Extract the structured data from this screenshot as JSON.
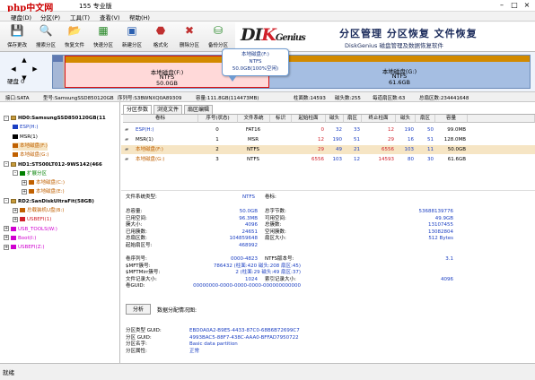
{
  "window": {
    "watermark": "php中文网",
    "title": "155 专业版"
  },
  "menu": [
    "硬盘(D)",
    "分区(P)",
    "工具(T)",
    "查看(V)",
    "帮助(H)"
  ],
  "toolbar": {
    "buttons": [
      {
        "label": "保存更改",
        "icon": "save-icon"
      },
      {
        "label": "搜索分区",
        "icon": "search-icon"
      },
      {
        "label": "恢复文件",
        "icon": "recover-icon"
      },
      {
        "label": "快速分区",
        "icon": "quick-partition-icon"
      },
      {
        "label": "新建分区",
        "icon": "new-partition-icon"
      },
      {
        "label": "格式化",
        "icon": "format-icon"
      },
      {
        "label": "删除分区",
        "icon": "delete-icon"
      },
      {
        "label": "备份分区",
        "icon": "backup-icon"
      }
    ],
    "logo": {
      "brand_a": "DI",
      "brand_k": "K",
      "brand_b": "Genius",
      "slogan": "分区管理 分区恢复 文件恢复",
      "sub": "DiskGenius 磁盘管理及数据恢复软件"
    }
  },
  "diskmap": {
    "disk_label": "硬盘 0",
    "segments": [
      {
        "name": "本地磁盘(F:)",
        "fs": "NTFS",
        "size": "50.0GB",
        "selected": true
      },
      {
        "name": "本地磁盘(G:)",
        "fs": "NTFS",
        "size": "61.6GB",
        "selected": false
      }
    ],
    "tooltip": [
      "本地磁盘(F:)",
      "NTFS",
      "50.0GB(100%空闲)"
    ]
  },
  "infobar": [
    "接口:SATA",
    "型号:SamsungSSD850120GB",
    "序列号:S3BWNXQ0A89309",
    "容量:111.8GB(114473MB)",
    "柱面数:14593",
    "磁头数:255",
    "每道扇区数:63",
    "总扇区数:234441648"
  ],
  "tree": [
    {
      "label": "HD0:SamsungSSD850120GB(11",
      "indent": 0,
      "expander": "-",
      "kind": "disk",
      "color": "#000",
      "bold": true
    },
    {
      "label": "ESP(H:)",
      "indent": 1,
      "expander": "",
      "kind": "part",
      "color": "#1b3fc2"
    },
    {
      "label": "MSR(1)",
      "indent": 1,
      "expander": "",
      "kind": "part",
      "color": "#000"
    },
    {
      "label": "本地磁盘(F:)",
      "indent": 1,
      "expander": "",
      "kind": "part",
      "color": "#c06000",
      "selected": true
    },
    {
      "label": "本地磁盘(G:)",
      "indent": 1,
      "expander": "",
      "kind": "part",
      "color": "#c06000"
    },
    {
      "label": "HD1:ST500LT012-9WS142(466",
      "indent": 0,
      "expander": "-",
      "kind": "disk",
      "color": "#000",
      "bold": true
    },
    {
      "label": "扩展分区",
      "indent": 1,
      "expander": "-",
      "kind": "part",
      "color": "#008000"
    },
    {
      "label": "本地磁盘(C:)",
      "indent": 2,
      "expander": "+",
      "kind": "part",
      "color": "#c06000"
    },
    {
      "label": "本地磁盘(E:)",
      "indent": 2,
      "expander": "+",
      "kind": "part",
      "color": "#c06000"
    },
    {
      "label": "RD2:SanDiskUltraFit(58GB)",
      "indent": 0,
      "expander": "-",
      "kind": "disk",
      "color": "#000",
      "bold": true
    },
    {
      "label": "总载装机U盘(B:)",
      "indent": 1,
      "expander": "+",
      "kind": "part",
      "color": "#c06000"
    },
    {
      "label": "USBEFI(1)",
      "indent": 1,
      "expander": "+",
      "kind": "part",
      "color": "#d0202a"
    },
    {
      "label": "USB_TOOLS(W:)",
      "indent": 0,
      "expander": "+",
      "kind": "part",
      "color": "#d000d0"
    },
    {
      "label": "Boot(I:)",
      "indent": 0,
      "expander": "+",
      "kind": "part",
      "color": "#d000d0"
    },
    {
      "label": "USBEFI(Z:)",
      "indent": 0,
      "expander": "+",
      "kind": "part",
      "color": "#d000d0"
    }
  ],
  "tabs": [
    "分区参数",
    "浏览文件",
    "扇区编辑"
  ],
  "partition_table": {
    "headers": [
      "卷标",
      "序号(状态)",
      "文件系统",
      "标识",
      "起始柱面",
      "磁头",
      "扇区",
      "终止柱面",
      "磁头",
      "扇区",
      "容量"
    ],
    "rows": [
      {
        "cells": [
          "ESP(H:)",
          "0",
          "FAT16",
          "",
          "0",
          "32",
          "33",
          "12",
          "190",
          "50",
          "99.0MB"
        ],
        "color": "#1b3fc2",
        "selected": false
      },
      {
        "cells": [
          "MSR(1)",
          "1",
          "MSR",
          "",
          "12",
          "190",
          "51",
          "29",
          "16",
          "51",
          "128.0MB"
        ],
        "color": "#000",
        "selected": false
      },
      {
        "cells": [
          "本地磁盘(F:)",
          "2",
          "NTFS",
          "",
          "29",
          "49",
          "21",
          "6556",
          "103",
          "11",
          "50.0GB"
        ],
        "color": "#c06000",
        "selected": true
      },
      {
        "cells": [
          "本地磁盘(G:)",
          "3",
          "NTFS",
          "",
          "6556",
          "103",
          "12",
          "14593",
          "80",
          "30",
          "61.6GB"
        ],
        "color": "#c06000",
        "selected": false
      }
    ]
  },
  "details": {
    "fs_type_label": "文件系统类型:",
    "fs_type": "NTFS",
    "vol_label_label": "卷标:",
    "rows": [
      {
        "l1": "总容量:",
        "v1": "50.0GB",
        "l2": "总字节数:",
        "v2": "53688139776"
      },
      {
        "l1": "已用空间:",
        "v1": "96.3MB",
        "l2": "可用空间:",
        "v2": "49.9GB"
      },
      {
        "l1": "簇大小:",
        "v1": "4096",
        "l2": "总簇数:",
        "v2": "13107455"
      },
      {
        "l1": "已用簇数:",
        "v1": "24651",
        "l2": "空闲簇数:",
        "v2": "13082804"
      },
      {
        "l1": "总扇区数:",
        "v1": "104859648",
        "l2": "扇区大小:",
        "v2": "512 Bytes"
      },
      {
        "l1": "起始扇区号:",
        "v1": "468992",
        "l2": "",
        "v2": ""
      }
    ],
    "rows2": [
      {
        "l1": "卷序列号:",
        "v1": "0000-4823",
        "l2": "NTFS版本号:",
        "v2": "3.1"
      },
      {
        "l1": "$MFT簇号:",
        "v1": "786432 (柱面:420 磁头:208 扇区:45)",
        "l2": "",
        "v2": ""
      },
      {
        "l1": "$MFTMirr簇号:",
        "v1": "2 (柱面:29 磁头:49 扇区:37)",
        "l2": "",
        "v2": ""
      },
      {
        "l1": "文件记录大小:",
        "v1": "1024",
        "l2": "索引记录大小:",
        "v2": "4096"
      },
      {
        "l1": "卷GUID:",
        "v1": "00000000-0000-0000-0000-000000000000",
        "l2": "",
        "v2": ""
      }
    ],
    "analyze_button": "分析",
    "analyze_label": "数据分配情况图:",
    "guid": [
      {
        "l": "分区类型 GUID:",
        "v": "EBD0A0A2-B9E5-4433-87C0-68B6B72699C7"
      },
      {
        "l": "分区 GUID:",
        "v": "4993BAC5-88F7-438C-AAA0-BFFAD7950722"
      },
      {
        "l": "分区名字:",
        "v": "Basic data partition"
      },
      {
        "l": "分区属性:",
        "v": "正常"
      }
    ]
  },
  "status": "就绪"
}
